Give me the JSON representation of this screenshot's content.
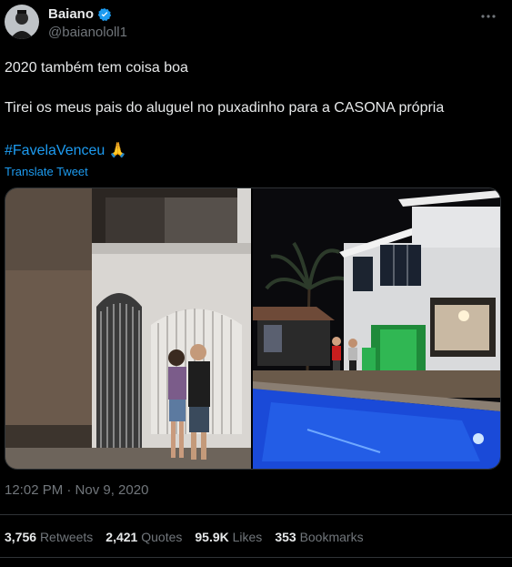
{
  "tweet": {
    "author": {
      "display_name": "Baiano",
      "handle": "@baianololl1",
      "verified": true
    },
    "lines": [
      "2020 também tem coisa boa",
      "Tirei os meus pais do aluguel no puxadinho para a CASONA própria"
    ],
    "hashtag": "#FavelaVenceu",
    "emoji": "🙏",
    "translate_label": "Translate Tweet",
    "photos": [
      {
        "subject": "old-house-couple"
      },
      {
        "subject": "mansion-pool-night"
      }
    ],
    "timestamp": "12:02 PM · Nov 9, 2020",
    "stats": [
      {
        "value": "3,756",
        "label": "Retweets"
      },
      {
        "value": "2,421",
        "label": "Quotes"
      },
      {
        "value": "95.9K",
        "label": "Likes"
      },
      {
        "value": "353",
        "label": "Bookmarks"
      }
    ]
  },
  "colors": {
    "background": "#000000",
    "text": "#e7e9ea",
    "muted": "#71767b",
    "accent": "#1d9bf0",
    "divider": "#2f3336"
  }
}
